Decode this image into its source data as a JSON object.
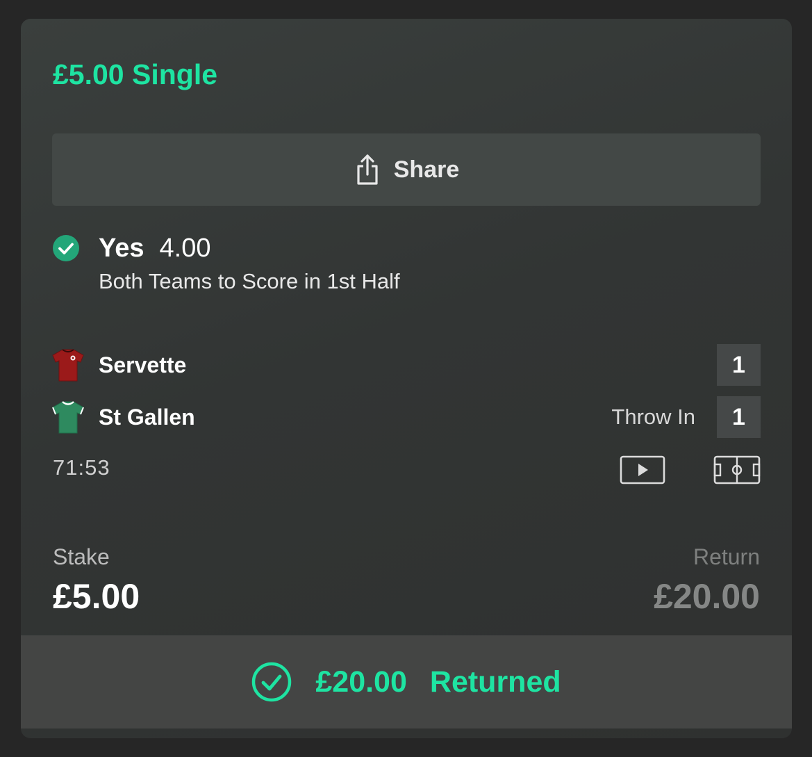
{
  "bet": {
    "title": "£5.00 Single"
  },
  "share": {
    "label": "Share",
    "icon": "share-icon"
  },
  "selection": {
    "status_icon": "check-circle-icon",
    "name": "Yes",
    "odds": "4.00",
    "market": "Both Teams to Score in 1st Half"
  },
  "match": {
    "teams": [
      {
        "name": "Servette",
        "score": "1",
        "shirt_color": "#9b1a1a",
        "status": ""
      },
      {
        "name": "St Gallen",
        "score": "1",
        "shirt_color": "#2e8a5f",
        "status": "Throw In"
      }
    ],
    "clock": "71:53",
    "actions": [
      "video-icon",
      "pitch-icon"
    ]
  },
  "stake": {
    "label": "Stake",
    "value": "£5.00"
  },
  "return": {
    "label": "Return",
    "value": "£20.00"
  },
  "result": {
    "amount": "£20.00",
    "label": "Returned",
    "icon": "check-circle-outline-icon"
  },
  "colors": {
    "accent": "#1ee4a2",
    "background": "#262626",
    "card": "#343736"
  }
}
